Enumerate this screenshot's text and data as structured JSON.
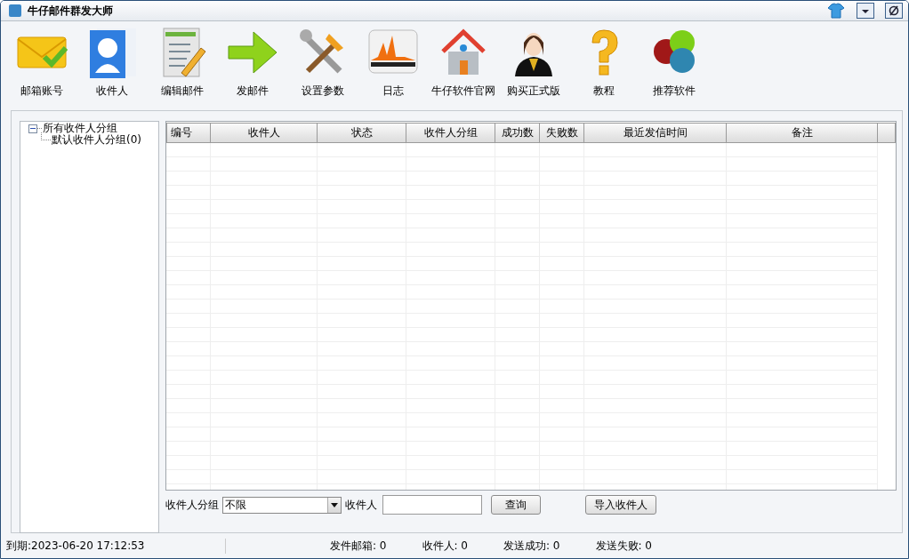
{
  "window": {
    "title": "牛仔邮件群发大师"
  },
  "toolbar": [
    {
      "label": "邮箱账号"
    },
    {
      "label": "收件人"
    },
    {
      "label": "编辑邮件"
    },
    {
      "label": "发邮件"
    },
    {
      "label": "设置参数"
    },
    {
      "label": "日志"
    },
    {
      "label": "牛仔软件官网"
    },
    {
      "label": "购买正式版"
    },
    {
      "label": "教程"
    },
    {
      "label": "推荐软件"
    }
  ],
  "tree": [
    {
      "label": "所有收件人分组",
      "expanded": true,
      "children": [
        {
          "label": "默认收件人分组(0)"
        }
      ]
    }
  ],
  "table": {
    "columns": [
      "编号",
      "收件人",
      "状态",
      "收件人分组",
      "成功数",
      "失败数",
      "最近发信时间",
      "备注"
    ]
  },
  "filter": {
    "group_label": "收件人分组",
    "group_value": "不限",
    "recipient_label": "收件人",
    "query_button": "查询",
    "import_button": "导入收件人"
  },
  "status_bar": {
    "expiry": "到期:2023-06-20 17:12:53",
    "items": [
      "发件邮箱: 0",
      "收件人: 0",
      "发送成功: 0",
      "发送失败: 0"
    ]
  }
}
